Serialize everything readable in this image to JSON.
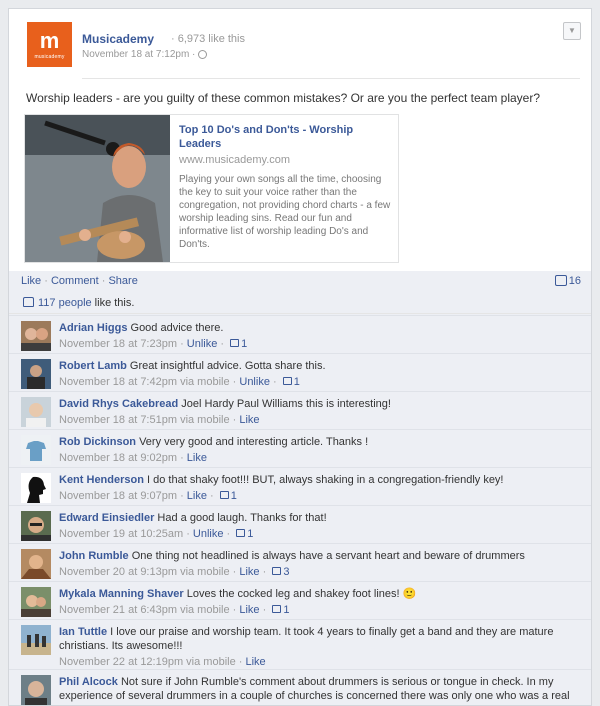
{
  "post": {
    "page_name": "Musicademy",
    "likes": "· 6,973 like this",
    "logo_letter": "m",
    "logo_text": "musicademy",
    "date": "November 18 at 7:12pm ·",
    "message": "Worship leaders - are you guilty of these common mistakes? Or are you the perfect team player?",
    "share": {
      "title": "Top 10 Do's and Don'ts - Worship Leaders",
      "url": "www.musicademy.com",
      "description": "Playing your own songs all the time, choosing the key to suit your voice rather than the congregation, not providing chord charts - a few worship leading sins. Read our fun and informative list of worship leading Do's and Don'ts."
    }
  },
  "actions": {
    "like": "Like",
    "comment": "Comment",
    "share": "Share",
    "comment_count": "16"
  },
  "likes_summary": {
    "people": "117 people",
    "suffix": " like this."
  },
  "comments": [
    {
      "name": "Adrian Higgs",
      "text": " Good advice there.",
      "date": "November 18 at 7:23pm",
      "action": "Unlike",
      "likes": "1"
    },
    {
      "name": "Robert Lamb",
      "text": " Great insightful advice. Gotta share this.",
      "date": "November 18 at 7:42pm via mobile",
      "action": "Unlike",
      "likes": "1"
    },
    {
      "name": "David Rhys Cakebread",
      "text": " Joel Hardy Paul Williams this is interesting!",
      "date": "November 18 at 7:51pm via mobile",
      "action": "Like",
      "likes": ""
    },
    {
      "name": "Rob Dickinson",
      "text": " Very very good and interesting article. Thanks !",
      "date": "November 18 at 9:02pm",
      "action": "Like",
      "likes": ""
    },
    {
      "name": "Kent Henderson",
      "text": " I do that shaky foot!!! BUT, always shaking in a congregation-friendly key!",
      "date": "November 18 at 9:07pm",
      "action": "Like",
      "likes": "1"
    },
    {
      "name": "Edward Einsiedler",
      "text": " Had a good laugh. Thanks for that!",
      "date": "November 19 at 10:25am",
      "action": "Unlike",
      "likes": "1"
    },
    {
      "name": "John Rumble",
      "text": " One thing not headlined is always have a servant heart and beware of drummers",
      "date": "November 20 at 9:13pm via mobile",
      "action": "Like",
      "likes": "3"
    },
    {
      "name": "Mykala Manning Shaver",
      "text": " Loves the cocked leg and shakey foot lines! 🙂",
      "date": "November 21 at 6:43pm via mobile",
      "action": "Like",
      "likes": "1"
    },
    {
      "name": "Ian Tuttle",
      "text": " I love our praise and worship team. It took 4 years to finally get a band and they are mature christians. Its awesome!!!",
      "date": "November 22 at 12:19pm via mobile",
      "action": "Like",
      "likes": ""
    },
    {
      "name": "Phil Alcock",
      "text": " Not sure if John Rumble's comment about drummers is serious or tongue in check. In my experience of several drummers in a couple of churches is concerned there was only one who was a real problem... You also have to 'beware' of any singer or musician who doesn't have a servant heart. Sorry but get a",
      "date": "",
      "action": "",
      "likes": ""
    }
  ],
  "colors": {
    "link": "#3b5998",
    "brand": "#e8601c",
    "ufi_bg": "#edeff4"
  }
}
